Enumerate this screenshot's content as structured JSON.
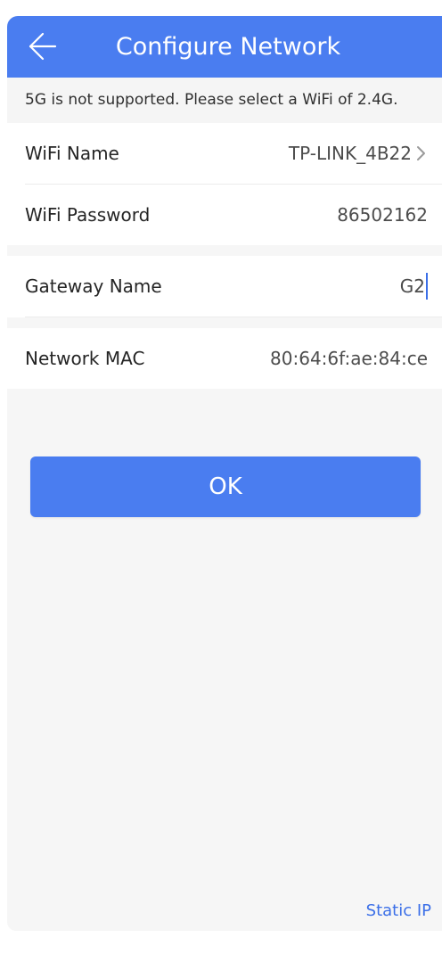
{
  "header": {
    "title": "Configure Network",
    "back_icon": "arrow-left-icon"
  },
  "notice": "5G is not supported. Please select a WiFi of 2.4G.",
  "wifi": {
    "name_label": "WiFi Name",
    "name_value": "TP-LINK_4B22",
    "name_icon": "chevron-right-icon",
    "password_label": "WiFi Password",
    "password_value": "86502162"
  },
  "gateway": {
    "label": "Gateway Name",
    "value": "G2"
  },
  "network": {
    "mac_label": "Network MAC",
    "mac_value": "80:64:6f:ae:84:ce"
  },
  "actions": {
    "ok_label": "OK",
    "static_ip_label": "Static IP"
  },
  "colors": {
    "primary": "#4a7df0",
    "background": "#f6f6f6",
    "link": "#3b6fe8"
  }
}
